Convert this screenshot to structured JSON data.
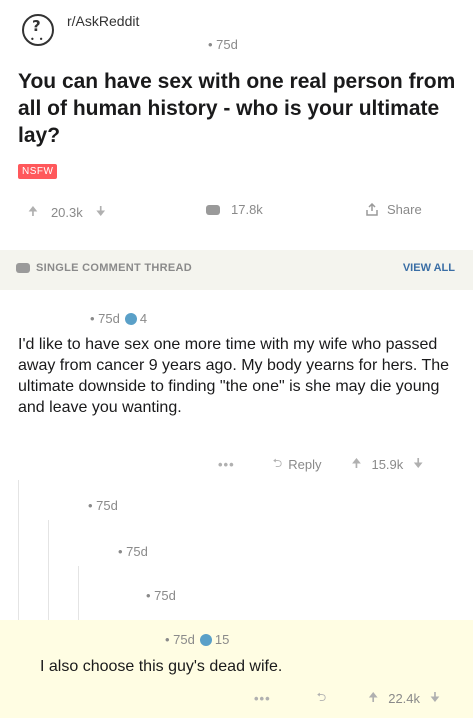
{
  "post": {
    "subreddit": "r/AskReddit",
    "time": "• 75d",
    "title": "You can have sex with one real person from all of human history - who is your ultimate lay?",
    "nsfw": "NSFW",
    "upvotes": "20.3k",
    "comments": "17.8k",
    "share": "Share"
  },
  "thread": {
    "label": "SINGLE COMMENT THREAD",
    "view_all": "VIEW ALL"
  },
  "comment": {
    "time": "• 75d",
    "awards": "4",
    "text": "I'd like to have sex one more time with my wife who passed away from cancer 9 years ago.  My body yearns for hers.  The ultimate downside to finding \"the one\" is she may die young and leave you wanting.",
    "dots": "•••",
    "reply": "Reply",
    "score": "15.9k"
  },
  "nested": [
    {
      "time": "• 75d"
    },
    {
      "time": "• 75d"
    },
    {
      "time": "• 75d"
    }
  ],
  "final_comment": {
    "time": "• 75d",
    "awards": "15",
    "text": "I also choose this guy's dead wife.",
    "dots": "•••",
    "score": "22.4k"
  },
  "colors": {
    "nsfw": "#ff585b",
    "thread_bar": "#f4f4ee",
    "highlight": "#fffde3",
    "link": "#3a6ea5",
    "award": "#5aa0c8"
  }
}
